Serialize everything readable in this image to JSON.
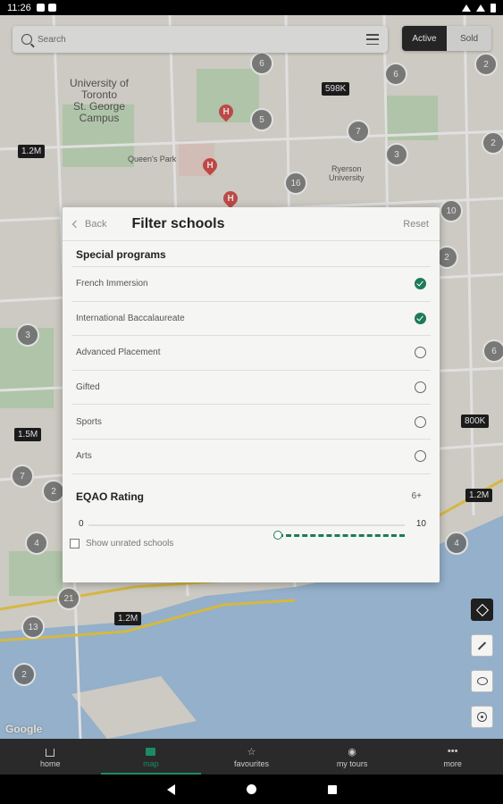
{
  "status_bar": {
    "time": "11:26"
  },
  "search": {
    "placeholder": "Search"
  },
  "listing_toggle": {
    "active": "Active",
    "sold": "Sold"
  },
  "map": {
    "campus_label": "University of Toronto St. George Campus",
    "campus_lines": [
      "University of",
      "Toronto",
      "St. George",
      "Campus"
    ],
    "ryerson_lines": [
      "Ryerson",
      "University"
    ],
    "queens_park": "Queen's Park",
    "price_pins": [
      "598K",
      "1.2M",
      "1.5M",
      "800K",
      "1.2M",
      "1.2M"
    ],
    "clusters": [
      "2",
      "6",
      "5",
      "7",
      "3",
      "16",
      "10",
      "2",
      "2",
      "3",
      "7",
      "6",
      "4",
      "21",
      "13",
      "2",
      "4",
      "6",
      "2"
    ],
    "attribution": "Google"
  },
  "filter_modal": {
    "back_label": "Back",
    "title": "Filter schools",
    "reset_label": "Reset",
    "section_title": "Special programs",
    "programs": [
      {
        "label": "French Immersion",
        "checked": true
      },
      {
        "label": "International Baccalaureate",
        "checked": true
      },
      {
        "label": "Advanced Placement",
        "checked": false
      },
      {
        "label": "Gifted",
        "checked": false
      },
      {
        "label": "Sports",
        "checked": false
      },
      {
        "label": "Arts",
        "checked": false
      }
    ],
    "eqao": {
      "title": "EQAO Rating",
      "value_label": "6+",
      "min_label": "0",
      "max_label": "10",
      "min": 0,
      "max": 10,
      "selected_min": 6,
      "selected_max": 10
    },
    "show_unrated_label": "Show unrated schools",
    "show_unrated_checked": false
  },
  "side_buttons": [
    "layers-icon",
    "draw-icon",
    "lasso-icon",
    "locate-icon"
  ],
  "bottom_nav": {
    "items": [
      {
        "label": "home",
        "icon": "home-icon",
        "active": false
      },
      {
        "label": "map",
        "icon": "map-icon",
        "active": true
      },
      {
        "label": "favourites",
        "icon": "star-icon",
        "active": false
      },
      {
        "label": "my tours",
        "icon": "eye-icon",
        "active": false
      },
      {
        "label": "more",
        "icon": "more-icon",
        "active": false
      }
    ]
  },
  "colors": {
    "accent": "#1d7a5a",
    "nav_bg": "#2a2a2a",
    "pin_bg": "#1f1f1f"
  }
}
